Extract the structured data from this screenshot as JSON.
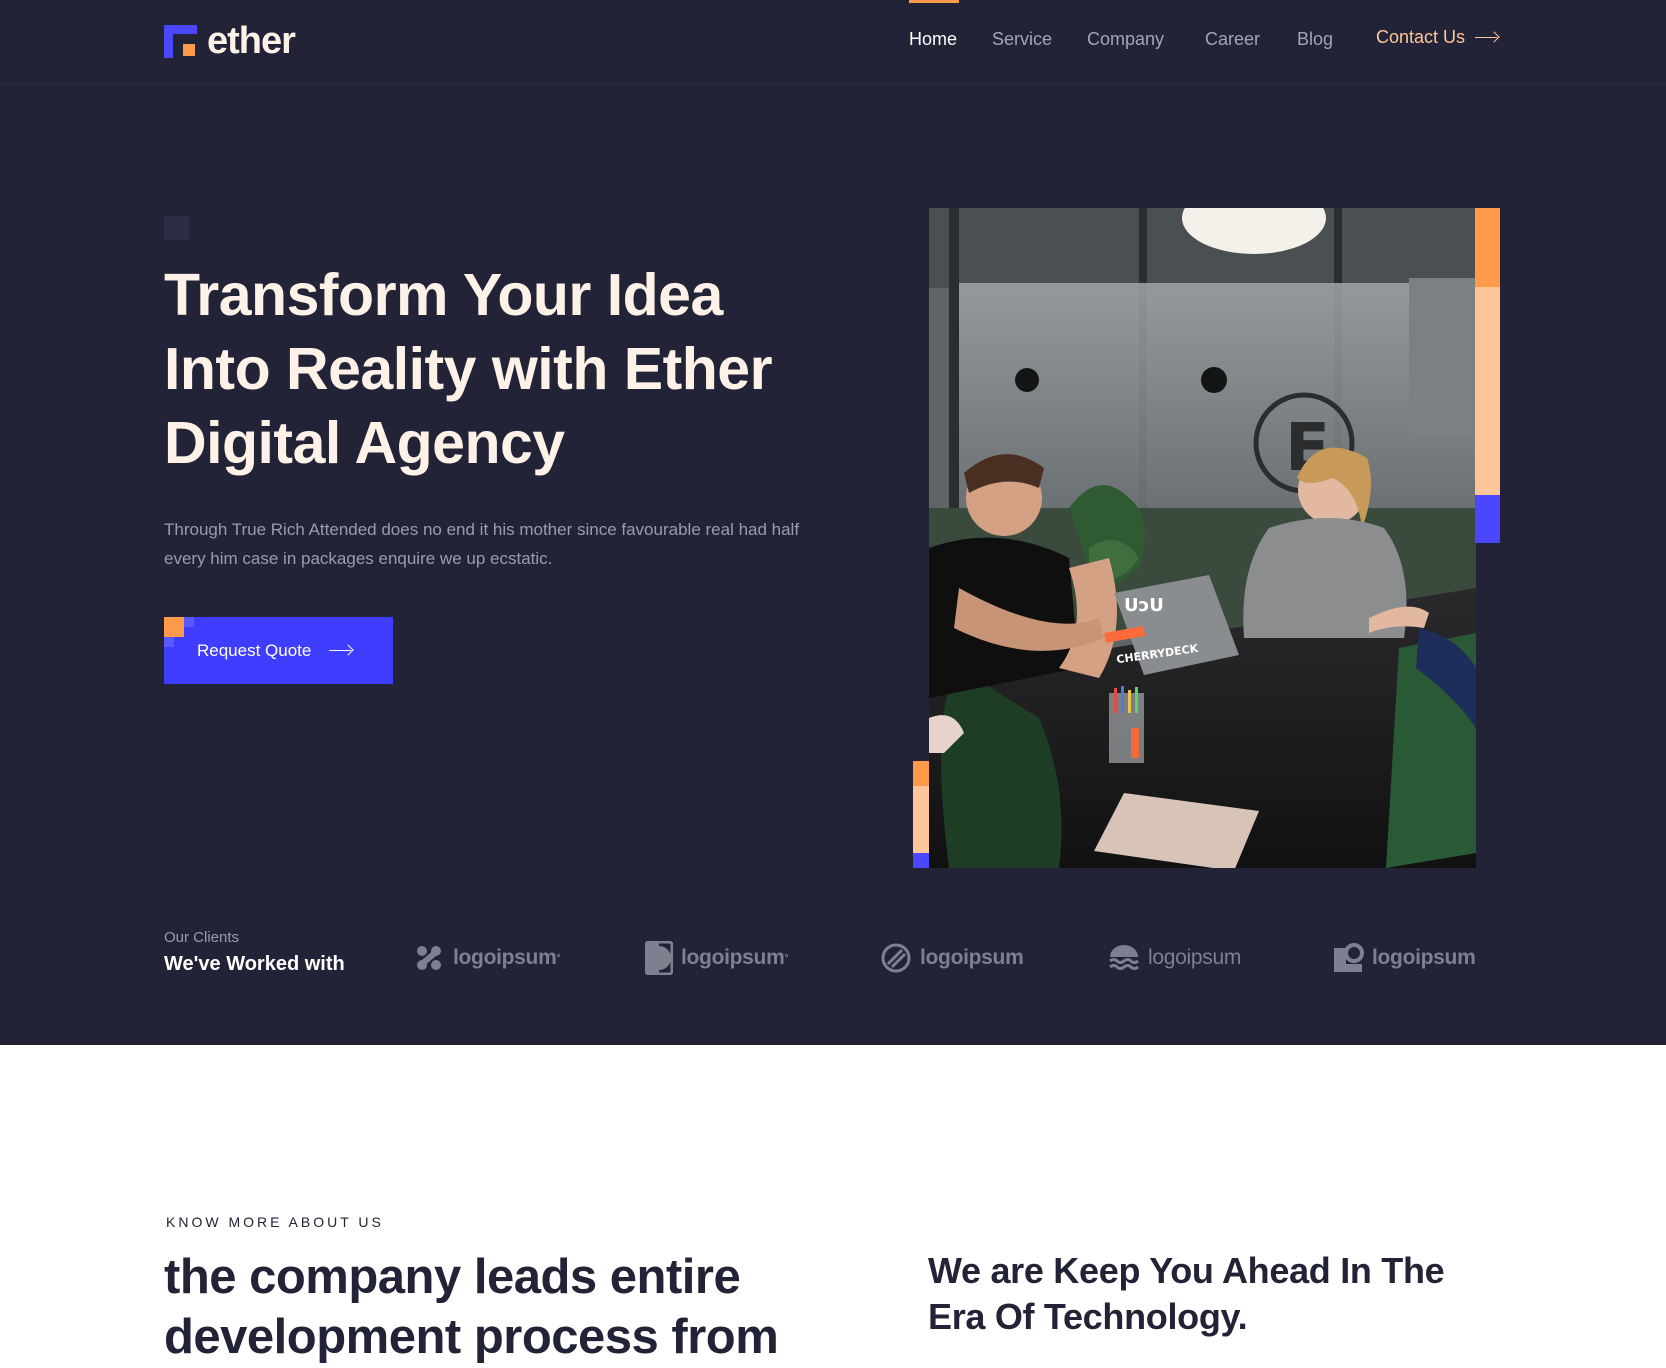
{
  "brand": {
    "name": "ether"
  },
  "nav": {
    "items": [
      {
        "label": "Home",
        "active": true
      },
      {
        "label": "Service",
        "active": false
      },
      {
        "label": "Company",
        "active": false
      },
      {
        "label": "Career",
        "active": false
      },
      {
        "label": "Blog",
        "active": false
      }
    ],
    "contact_label": "Contact Us"
  },
  "hero": {
    "title_lines": [
      "Transform Your Idea",
      "Into Reality with Ether",
      "Digital Agency"
    ],
    "description": "Through True Rich Attended does no end it his mother since favourable real had half every him case in packages enquire we up ecstatic.",
    "cta_label": "Request Quote"
  },
  "clients": {
    "subtitle": "Our Clients",
    "title": "We've Worked with",
    "logos": [
      "logoipsum",
      "logoipsum",
      "logoipsum",
      "logoipsum",
      "logoipsum"
    ],
    "logo_marks": [
      "°",
      "°",
      "",
      "",
      ""
    ]
  },
  "about": {
    "kicker": "KNOW MORE ABOUT US",
    "title_lines": [
      "the company leads entire",
      "development process from"
    ],
    "right_lines": [
      "We are Keep You Ahead In The",
      "Era Of Technology."
    ]
  },
  "photo": {
    "laptop_sticker": "CHERRYDECK",
    "laptop_logo": "UɔU"
  },
  "colors": {
    "hero_bg": "#222336",
    "accent_blue": "#3f3dff",
    "accent_orange": "#ff9a4a",
    "accent_peach": "#ffc799",
    "title_text": "#fdf1e8"
  },
  "icons": [
    "arrow-right-icon",
    "hash-logo-icon",
    "half-circle-logo-icon",
    "slashed-circle-logo-icon",
    "waves-logo-icon",
    "square-circle-logo-icon"
  ]
}
